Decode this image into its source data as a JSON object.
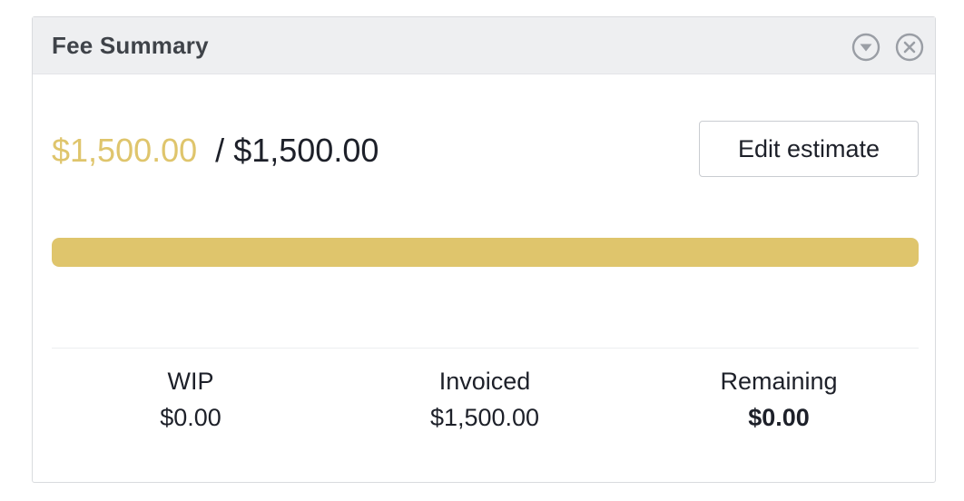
{
  "panel": {
    "title": "Fee Summary",
    "icons": {
      "collapse": "chevron-down-circle-icon",
      "close": "close-circle-icon"
    }
  },
  "summary": {
    "used_amount": "$1,500.00",
    "separator": "/",
    "total_amount": "$1,500.00",
    "progress_fraction": 1.0
  },
  "actions": {
    "edit_estimate_label": "Edit estimate"
  },
  "stats": {
    "wip_label": "WIP",
    "wip_value": "$0.00",
    "invoiced_label": "Invoiced",
    "invoiced_value": "$1,500.00",
    "remaining_label": "Remaining",
    "remaining_value": "$0.00"
  },
  "colors": {
    "accent": "#dfc56c",
    "text": "#1d2029",
    "header_bg": "#eeeff1"
  }
}
